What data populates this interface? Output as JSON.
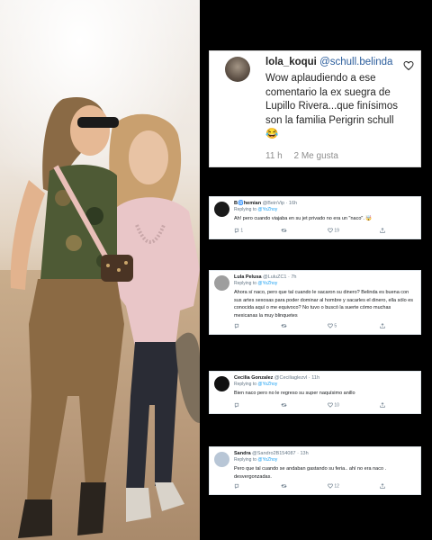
{
  "instagram_comment": {
    "username": "lola_koqui",
    "mention": "@schull.belinda",
    "text": "Wow aplaudiendo a ese comentario la ex suegra de Lupillo Rivera...que finísimos son la familia Perigrin schull 😂",
    "time": "11 h",
    "likes": "2 Me gusta",
    "icons": [
      "avatar",
      "heart-icon"
    ]
  },
  "replies": [
    {
      "name": "B🌀hemian",
      "handle": "@BeinVip · 16h",
      "replying_label": "Replying to",
      "replying_to": "@YoZhoy",
      "text": "Ah! pero cuando viajaba en su jet privado no era un \"naco\". 🤯",
      "comments": "1",
      "retweets": "",
      "likes": "19",
      "avatar_color": "#1a1a1a"
    },
    {
      "name": "Lula Pelusa",
      "handle": "@LuluZC1 · 7h",
      "replying_label": "Replying to",
      "replying_to": "@YoZhoy",
      "text": "Ahora sí naco, pero que tal cuando le sacaron su dinero? Belinda es buena con sus artes sexosas para poder dominar al hombre y sacarles el dinero, ella sólo es conocida aquí o me equivoco? No tuvo o buscó la suerte cómo muchas mexicanas la muy blinquetes",
      "comments": "",
      "retweets": "",
      "likes": "5",
      "avatar_color": "#9e9e9e"
    },
    {
      "name": "Cecilia Gonzalez",
      "handle": "@CeciliaglezvI · 11h",
      "replying_label": "Replying to",
      "replying_to": "@YoZhoy",
      "text": "Bien naco pero no le regreso su super naquísimo anillo",
      "comments": "",
      "retweets": "",
      "likes": "10",
      "avatar_color": "#111111"
    },
    {
      "name": "Sandra",
      "handle": "@Sandro2B154087 · 13h",
      "replying_label": "Replying to",
      "replying_to": "@YoZhoy",
      "text": "Pero que tal cuando se andaban gastando su feria.. ahí no era naco . desvergonzadas.",
      "comments": "",
      "retweets": "",
      "likes": "12",
      "avatar_color": "#b8c6d6"
    }
  ]
}
